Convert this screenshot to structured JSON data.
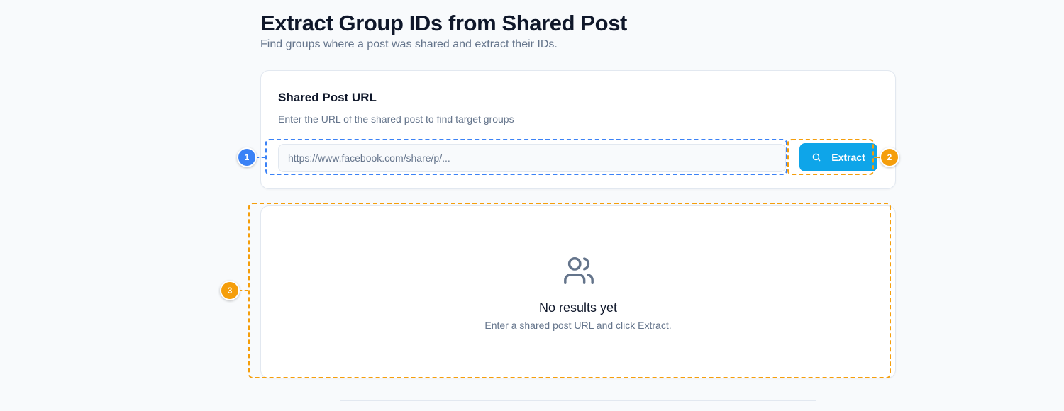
{
  "header": {
    "title": "Extract Group IDs from Shared Post",
    "subtitle": "Find groups where a post was shared and extract their IDs."
  },
  "input_card": {
    "title": "Shared Post URL",
    "description": "Enter the URL of the shared post to find target groups",
    "url_input": {
      "value": "",
      "placeholder": "https://www.facebook.com/share/p/..."
    },
    "extract_button": {
      "label": "Extract",
      "icon": "search-icon"
    }
  },
  "results_card": {
    "icon": "users-icon",
    "empty_title": "No results yet",
    "empty_description": "Enter a shared post URL and click Extract."
  },
  "annotations": [
    {
      "label": "1",
      "color": "#3b82f6"
    },
    {
      "label": "2",
      "color": "#f59e0b"
    },
    {
      "label": "3",
      "color": "#f59e0b"
    }
  ],
  "colors": {
    "accent": "#0ea5e9",
    "background": "#f8fafc",
    "text_primary": "#0f172a",
    "text_muted": "#64748b",
    "border": "#e2e8f0"
  }
}
